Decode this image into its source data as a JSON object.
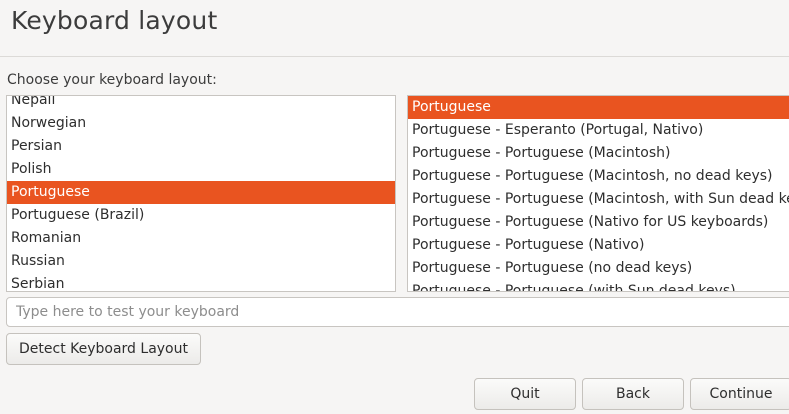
{
  "header": {
    "title": "Keyboard layout"
  },
  "prompt": "Choose your keyboard layout:",
  "layouts": [
    {
      "label": "Nepali",
      "selected": false
    },
    {
      "label": "Norwegian",
      "selected": false
    },
    {
      "label": "Persian",
      "selected": false
    },
    {
      "label": "Polish",
      "selected": false
    },
    {
      "label": "Portuguese",
      "selected": true
    },
    {
      "label": "Portuguese (Brazil)",
      "selected": false
    },
    {
      "label": "Romanian",
      "selected": false
    },
    {
      "label": "Russian",
      "selected": false
    },
    {
      "label": "Serbian",
      "selected": false
    }
  ],
  "variants": [
    {
      "label": "Portuguese",
      "selected": true
    },
    {
      "label": "Portuguese - Esperanto (Portugal, Nativo)",
      "selected": false
    },
    {
      "label": "Portuguese - Portuguese (Macintosh)",
      "selected": false
    },
    {
      "label": "Portuguese - Portuguese (Macintosh, no dead keys)",
      "selected": false
    },
    {
      "label": "Portuguese - Portuguese (Macintosh, with Sun dead keys)",
      "selected": false
    },
    {
      "label": "Portuguese - Portuguese (Nativo for US keyboards)",
      "selected": false
    },
    {
      "label": "Portuguese - Portuguese (Nativo)",
      "selected": false
    },
    {
      "label": "Portuguese - Portuguese (no dead keys)",
      "selected": false
    },
    {
      "label": "Portuguese - Portuguese (with Sun dead keys)",
      "selected": false
    }
  ],
  "test_input": {
    "placeholder": "Type here to test your keyboard",
    "value": ""
  },
  "buttons": {
    "detect": "Detect Keyboard Layout",
    "quit": "Quit",
    "back": "Back",
    "continue": "Continue"
  },
  "colors": {
    "accent": "#e95420",
    "window_bg": "#f6f5f4"
  }
}
